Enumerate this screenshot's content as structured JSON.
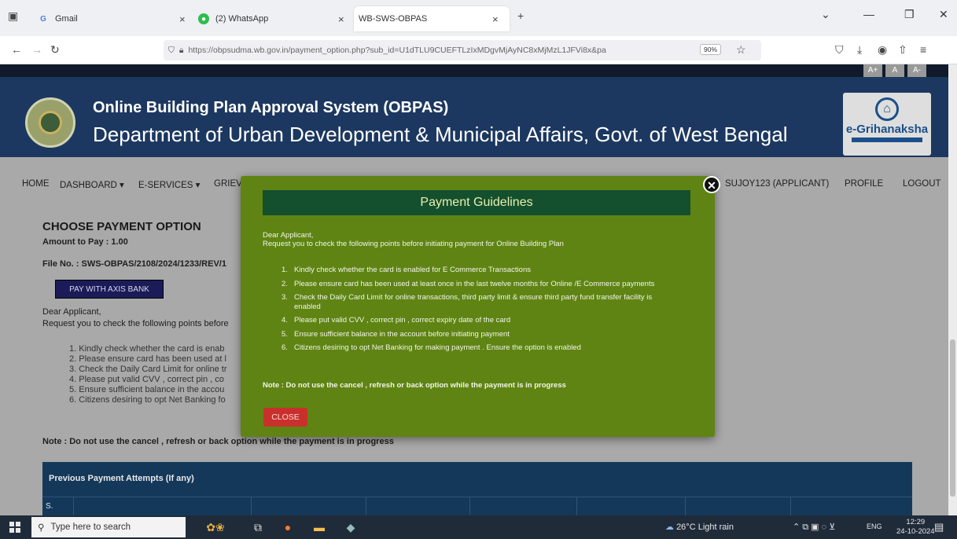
{
  "browser": {
    "tabs": [
      {
        "title": "Gmail",
        "icon": "gmail-icon"
      },
      {
        "title": "(2) WhatsApp",
        "icon": "whatsapp-icon"
      },
      {
        "title": "WB-SWS-OBPAS",
        "icon": "none"
      }
    ],
    "url": "https://obpsudma.wb.gov.in/payment_option.php?sub_id=U1dTLU9CUEFTLzIxMDgvMjAyNC8xMjMzL1JFVi8x&pa",
    "zoom": "90%"
  },
  "site": {
    "font_buttons": [
      "A+",
      "A",
      "A-"
    ],
    "title": "Online Building Plan Approval System (OBPAS)",
    "department": "Department of Urban Development & Municipal Affairs, Govt. of West Bengal",
    "logo_text": "e-Grihanaksha"
  },
  "nav": {
    "home": "HOME",
    "dashboard": "DASHBOARD ▾",
    "eservices": "E-SERVICES ▾",
    "grievance": "GRIEV",
    "user": "SUJOY123 (APPLICANT)",
    "profile": "PROFILE",
    "logout": "LOGOUT"
  },
  "payment_page": {
    "heading": "CHOOSE PAYMENT OPTION",
    "amount": "Amount to Pay : 1.00",
    "file_no": "File No. : SWS-OBPAS/2108/2024/1233/REV/1",
    "pay_button": "PAY WITH AXIS BANK",
    "dear": "Dear Applicant,",
    "request": "Request you to check the following points before",
    "points": [
      "1. Kindly check whether the card is enab",
      "2. Please ensure card has been used at l",
      "3. Check the Daily Card Limit for online tr",
      "4. Please put valid CVV , correct pin , co",
      "5. Ensure sufficient balance in the accou",
      "6. Citizens desiring to opt Net Banking fo"
    ],
    "note": "Note : Do not use the cancel , refresh or back option while the payment is in progress",
    "attempts_title": "Previous Payment Attempts (If any)",
    "attempts_first_col": "S."
  },
  "modal": {
    "title": "Payment Guidelines",
    "dear": "Dear Applicant,",
    "request": "Request you to check the following points before initiating payment for Online Building Plan",
    "points": [
      {
        "num": "1.",
        "text": "Kindly check whether the card is enabled for E Commerce Transactions"
      },
      {
        "num": "2.",
        "text": "Please ensure card has been used at least once in the last twelve months for Online /E Commerce payments"
      },
      {
        "num": "3.",
        "text": "Check the Daily Card Limit for online transactions, third party limit & ensure third party fund transfer facility is enabled"
      },
      {
        "num": "4.",
        "text": "Please put valid CVV , correct pin , correct expiry date of the card"
      },
      {
        "num": "5.",
        "text": "Ensure sufficient balance in the account before initiating payment"
      },
      {
        "num": "6.",
        "text": "Citizens desiring to opt Net Banking for making payment . Ensure the option is enabled"
      }
    ],
    "note": "Note : Do not use the cancel , refresh or back option while the payment is in progress",
    "close_label": "CLOSE",
    "close_icon_glyph": "✕"
  },
  "taskbar": {
    "search_placeholder": "Type here to search",
    "weather": "26°C  Light rain",
    "lang": "ENG",
    "time": "12:29",
    "date": "24-10-2024"
  },
  "colors": {
    "header_bg": "#1c3860",
    "modal_bg": "#5f8414",
    "modal_header_bg": "#14502e",
    "close_btn": "#c9302c",
    "pay_btn": "#1b1b58"
  }
}
